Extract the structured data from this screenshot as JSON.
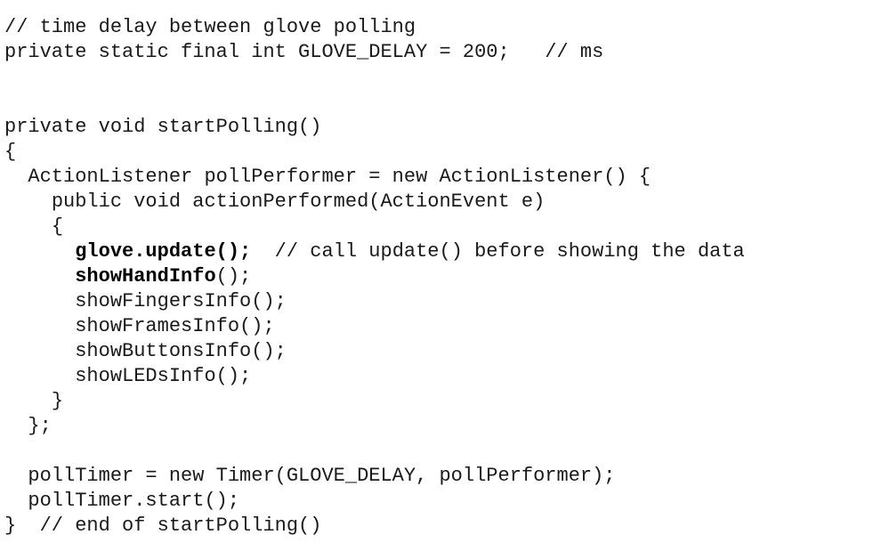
{
  "code": {
    "lines": [
      {
        "indent": "",
        "segments": [
          {
            "text": "// time delay between glove polling",
            "bold": false
          }
        ]
      },
      {
        "indent": "",
        "segments": [
          {
            "text": "private static final int GLOVE_DELAY = 200;   // ms",
            "bold": false
          }
        ]
      },
      {
        "indent": "",
        "segments": []
      },
      {
        "indent": "",
        "segments": []
      },
      {
        "indent": "",
        "segments": [
          {
            "text": "private void startPolling()",
            "bold": false
          }
        ]
      },
      {
        "indent": "",
        "segments": [
          {
            "text": "{",
            "bold": false
          }
        ]
      },
      {
        "indent": "  ",
        "segments": [
          {
            "text": "ActionListener pollPerformer = new ActionListener() {",
            "bold": false
          }
        ]
      },
      {
        "indent": "    ",
        "segments": [
          {
            "text": "public void actionPerformed(ActionEvent e)",
            "bold": false
          }
        ]
      },
      {
        "indent": "    ",
        "segments": [
          {
            "text": "{",
            "bold": false
          }
        ]
      },
      {
        "indent": "      ",
        "segments": [
          {
            "text": "glove.update();",
            "bold": true
          },
          {
            "text": "  // call update() before showing the data",
            "bold": false
          }
        ]
      },
      {
        "indent": "      ",
        "segments": [
          {
            "text": "showHandInfo",
            "bold": true
          },
          {
            "text": "();",
            "bold": false
          }
        ]
      },
      {
        "indent": "      ",
        "segments": [
          {
            "text": "showFingersInfo();",
            "bold": false
          }
        ]
      },
      {
        "indent": "      ",
        "segments": [
          {
            "text": "showFramesInfo();",
            "bold": false
          }
        ]
      },
      {
        "indent": "      ",
        "segments": [
          {
            "text": "showButtonsInfo();",
            "bold": false
          }
        ]
      },
      {
        "indent": "      ",
        "segments": [
          {
            "text": "showLEDsInfo();",
            "bold": false
          }
        ]
      },
      {
        "indent": "    ",
        "segments": [
          {
            "text": "}",
            "bold": false
          }
        ]
      },
      {
        "indent": "  ",
        "segments": [
          {
            "text": "};",
            "bold": false
          }
        ]
      },
      {
        "indent": "",
        "segments": []
      },
      {
        "indent": "  ",
        "segments": [
          {
            "text": "pollTimer = new Timer(GLOVE_DELAY, pollPerformer);",
            "bold": false
          }
        ]
      },
      {
        "indent": "  ",
        "segments": [
          {
            "text": "pollTimer.start();",
            "bold": false
          }
        ]
      },
      {
        "indent": "",
        "segments": [
          {
            "text": "}  // end of startPolling()",
            "bold": false
          }
        ]
      }
    ]
  }
}
